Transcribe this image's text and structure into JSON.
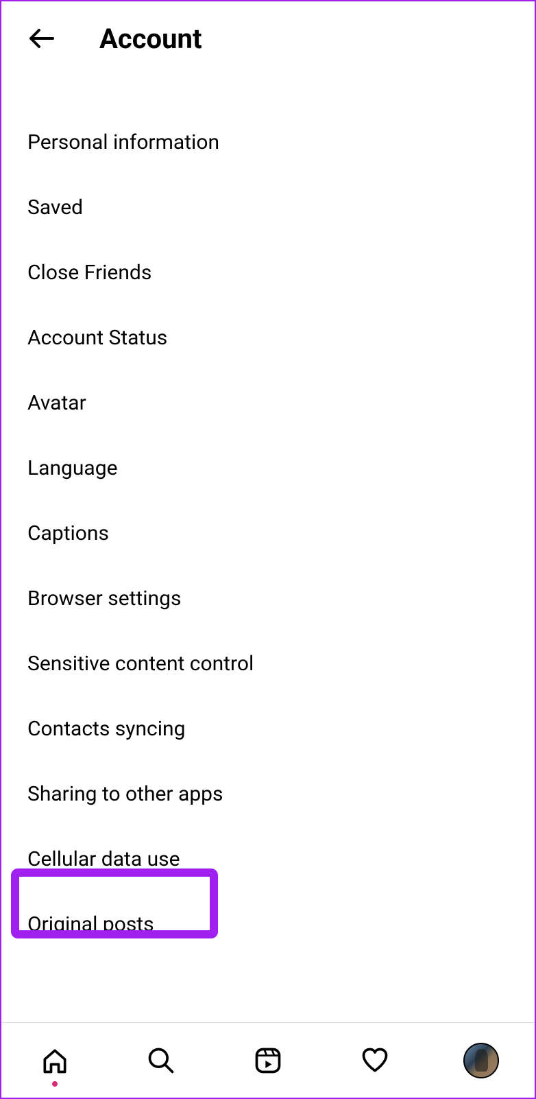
{
  "header": {
    "title": "Account"
  },
  "menu": {
    "items": [
      {
        "label": "Personal information"
      },
      {
        "label": "Saved"
      },
      {
        "label": "Close Friends"
      },
      {
        "label": "Account Status"
      },
      {
        "label": "Avatar"
      },
      {
        "label": "Language"
      },
      {
        "label": "Captions"
      },
      {
        "label": "Browser settings"
      },
      {
        "label": "Sensitive content control"
      },
      {
        "label": "Contacts syncing"
      },
      {
        "label": "Sharing to other apps"
      },
      {
        "label": "Cellular data use",
        "highlighted": true
      },
      {
        "label": "Original posts"
      }
    ]
  },
  "nav": {
    "home": "home-icon",
    "search": "search-icon",
    "reels": "reels-icon",
    "activity": "heart-icon",
    "profile": "profile-avatar"
  }
}
